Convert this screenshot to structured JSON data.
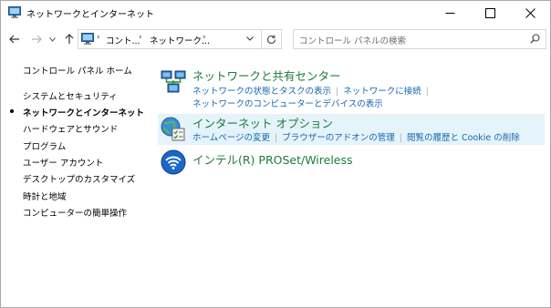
{
  "window": {
    "title": "ネットワークとインターネット"
  },
  "address": {
    "crumbs": [
      "コント...",
      "ネットワーク..."
    ]
  },
  "search": {
    "placeholder": "コントロール パネルの検索"
  },
  "sidebar": {
    "home": "コントロール パネル ホーム",
    "items": [
      {
        "label": "システムとセキュリティ",
        "current": false
      },
      {
        "label": "ネットワークとインターネット",
        "current": true
      },
      {
        "label": "ハードウェアとサウンド",
        "current": false
      },
      {
        "label": "プログラム",
        "current": false
      },
      {
        "label": "ユーザー アカウント",
        "current": false
      },
      {
        "label": "デスクトップのカスタマイズ",
        "current": false
      },
      {
        "label": "時計と地域",
        "current": false
      },
      {
        "label": "コンピューターの簡単操作",
        "current": false
      }
    ]
  },
  "categories": [
    {
      "title": "ネットワークと共有センター",
      "icon": "network-sharing-icon",
      "links": [
        [
          "ネットワークの状態とタスクの表示",
          "ネットワークに接続"
        ],
        [
          "ネットワークのコンピューターとデバイスの表示"
        ]
      ]
    },
    {
      "title": "インターネット オプション",
      "icon": "internet-options-icon",
      "links": [
        [
          "ホームページの変更",
          "ブラウザーのアドオンの管理",
          "閲覧の履歴と Cookie の削除"
        ]
      ]
    },
    {
      "title": "インテル(R) PROSet/Wireless",
      "icon": "wireless-icon",
      "links": []
    }
  ],
  "colors": {
    "category_title": "#1e7b3a",
    "link": "#1766ae",
    "selected_bg": "#e5f3fb"
  }
}
